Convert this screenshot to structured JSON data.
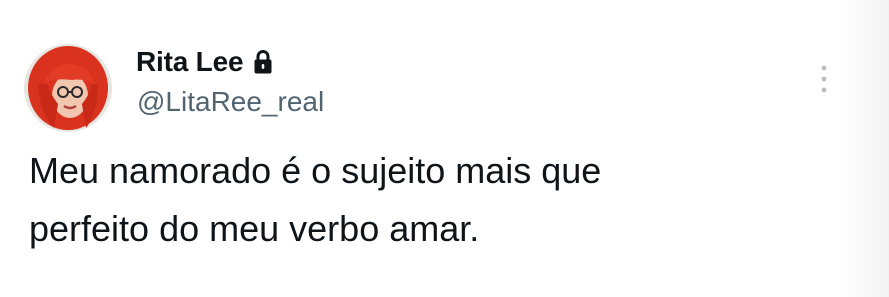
{
  "tweet": {
    "author": {
      "display_name": "Rita Lee",
      "handle": "@LitaRee_real",
      "avatar_icon": "avatar-photo",
      "verified_icon": "lock-icon"
    },
    "text_lines": [
      "Meu namorado é o sujeito mais que",
      "perfeito do meu verbo amar."
    ],
    "menu_icon": "more-options-icon"
  },
  "colors": {
    "background": "#ffffff",
    "text_primary": "#0f1419",
    "text_secondary": "#536471",
    "icon_muted": "#b8bfc6",
    "avatar_hair": "#e0321f"
  }
}
